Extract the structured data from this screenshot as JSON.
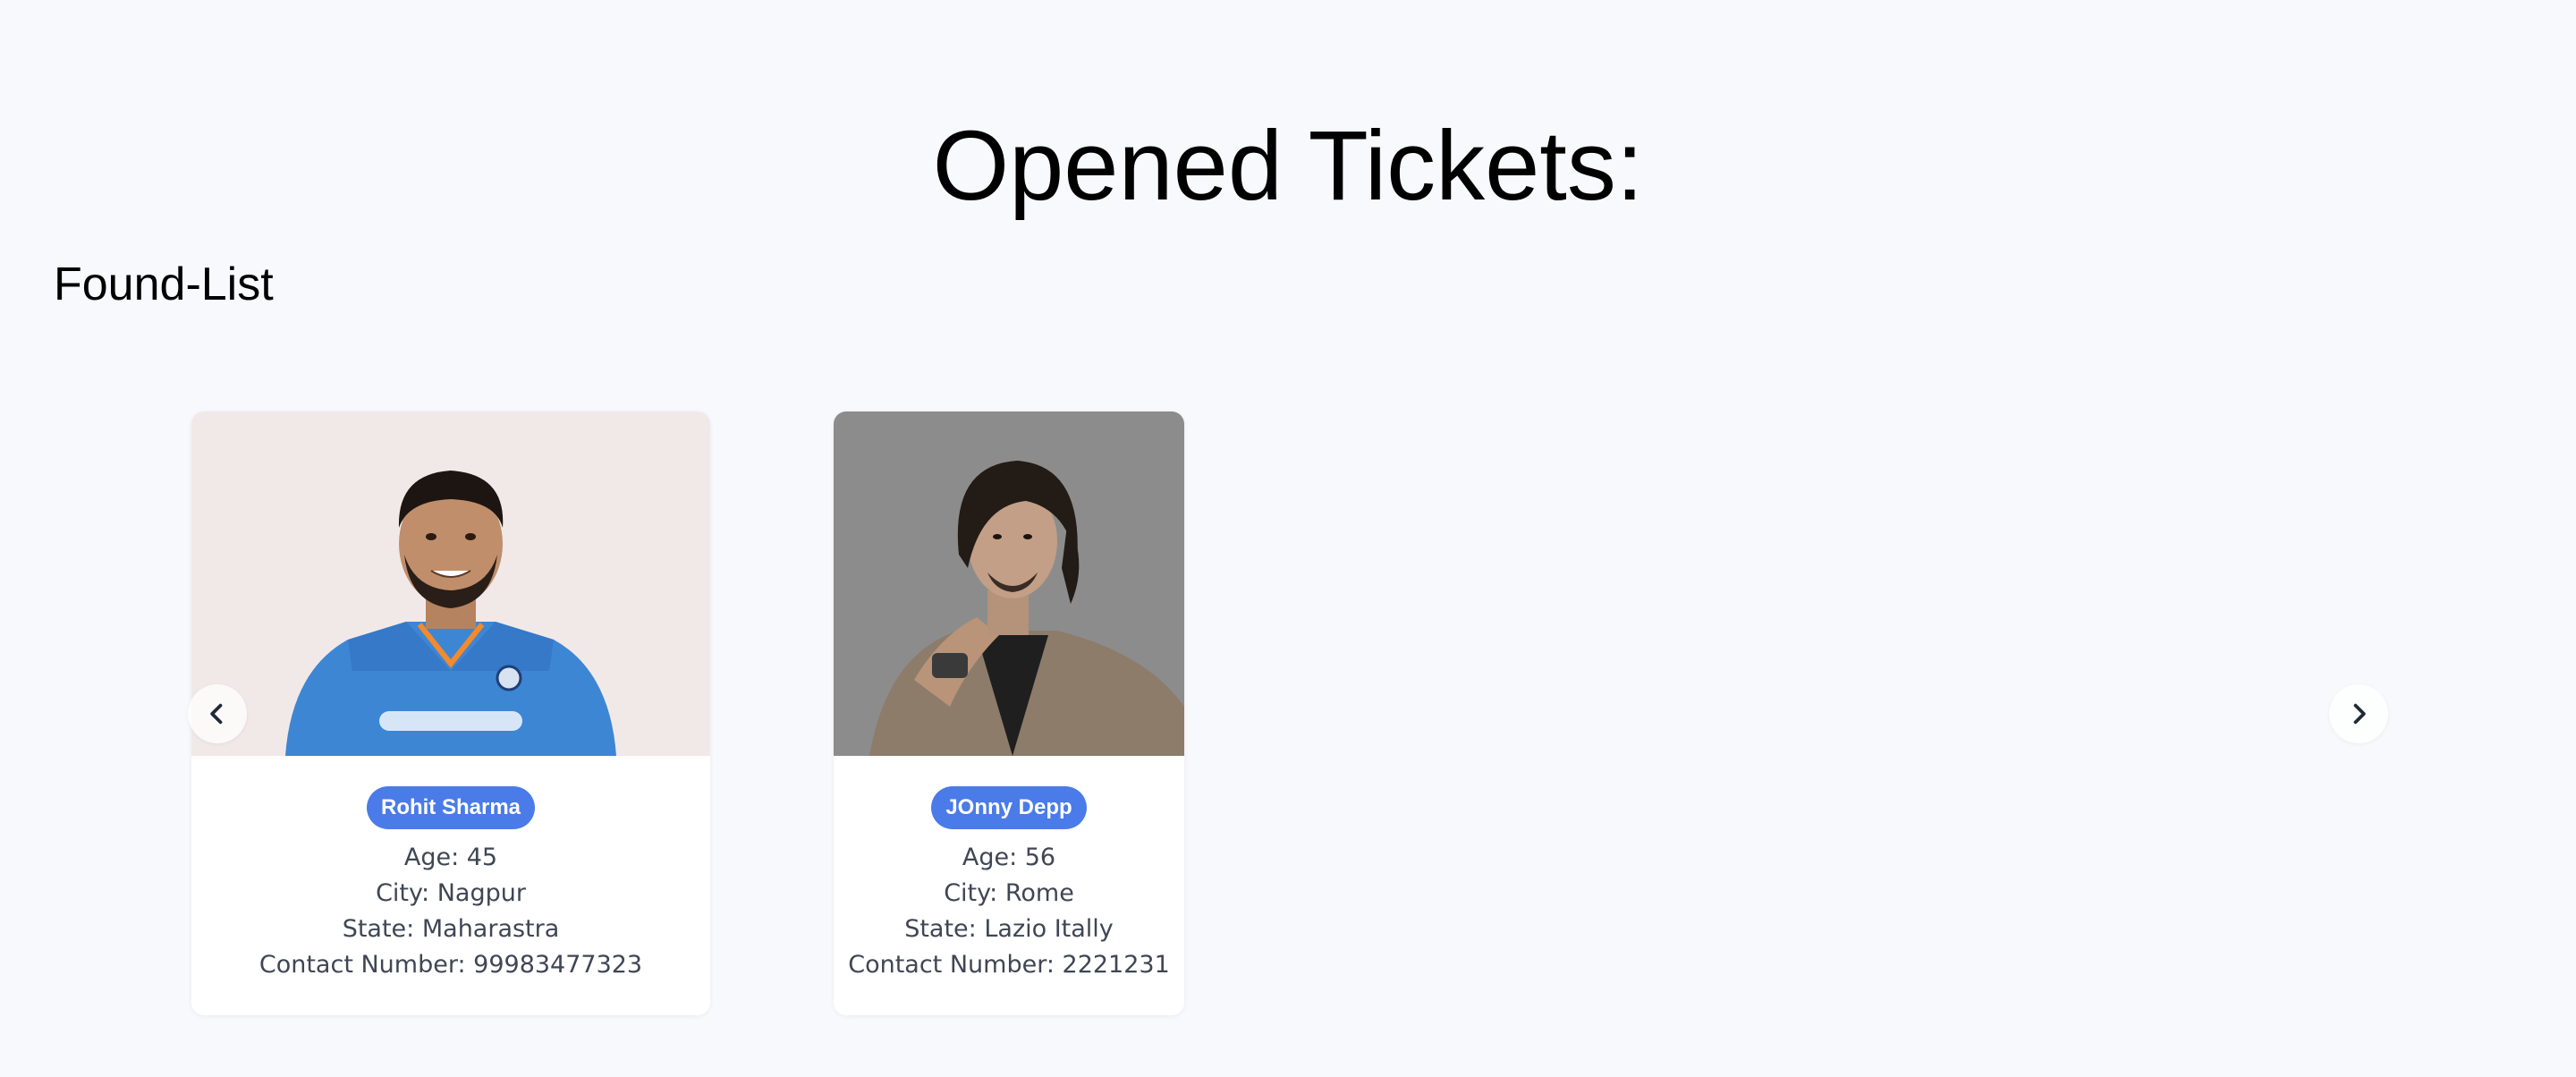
{
  "header": {
    "title": "Opened Tickets:",
    "section_title": "Found-List"
  },
  "carousel": {
    "prev_icon": "chevron-left-icon",
    "next_icon": "chevron-right-icon",
    "cards": [
      {
        "name": "Rohit Sharma",
        "photo_description": "man in blue cricket jersey",
        "age": "Age: 45",
        "city": "City: Nagpur",
        "state": "State: Maharastra",
        "contact": "Contact Number: 99983477323"
      },
      {
        "name": "JOnny Depp",
        "photo_description": "man in tan blazer, grey background",
        "age": "Age: 56",
        "city": "City: Rome",
        "state": "State: Lazio Itally",
        "contact": "Contact Number: 2221231"
      }
    ]
  },
  "colors": {
    "background": "#f8f9fc",
    "badge": "#4a7be8",
    "detail_text": "#3f4654"
  }
}
